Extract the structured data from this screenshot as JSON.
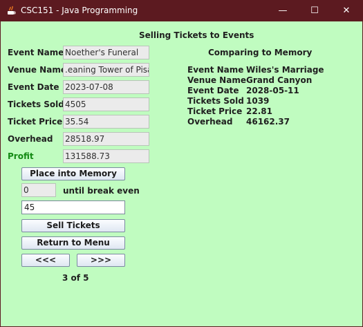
{
  "window": {
    "title": "CSC151 - Java Programming",
    "controls": {
      "minimize": "—",
      "maximize": "☐",
      "close": "✕"
    }
  },
  "form": {
    "heading": "Selling Tickets to Events",
    "fields": [
      {
        "label": "Event Name",
        "value": "Noether's Funeral"
      },
      {
        "label": "Venue Name",
        "value": ".eaning Tower of Pisa"
      },
      {
        "label": "Event Date",
        "value": "2023-07-08"
      },
      {
        "label": "Tickets Sold",
        "value": "4505"
      },
      {
        "label": "Ticket Price",
        "value": "35.54"
      },
      {
        "label": "Overhead",
        "value": "28518.97"
      },
      {
        "label": "Profit",
        "value": "131588.73"
      }
    ],
    "place_into_memory_label": "Place into Memory",
    "break_even_value": "0",
    "break_even_label": "until break even",
    "sell_quantity": "45",
    "sell_tickets_label": "Sell Tickets",
    "return_to_menu_label": "Return to Menu",
    "prev_label": "<<<",
    "next_label": ">>>",
    "page_indicator": "3 of 5"
  },
  "memory": {
    "heading": "Comparing to Memory",
    "rows": [
      {
        "label": "Event Name",
        "value": "Wiles's Marriage"
      },
      {
        "label": "Venue Name",
        "value": "Grand Canyon"
      },
      {
        "label": "Event Date",
        "value": "2028-05-11"
      },
      {
        "label": "Tickets Sold",
        "value": "1039"
      },
      {
        "label": "Ticket Price",
        "value": "22.81"
      },
      {
        "label": "Overhead",
        "value": "46162.37"
      }
    ]
  },
  "colors": {
    "titlebar": "#5c1a20",
    "background": "#c0fcc0",
    "profit_label": "#138a13"
  },
  "icons": {
    "app": "java-icon"
  }
}
